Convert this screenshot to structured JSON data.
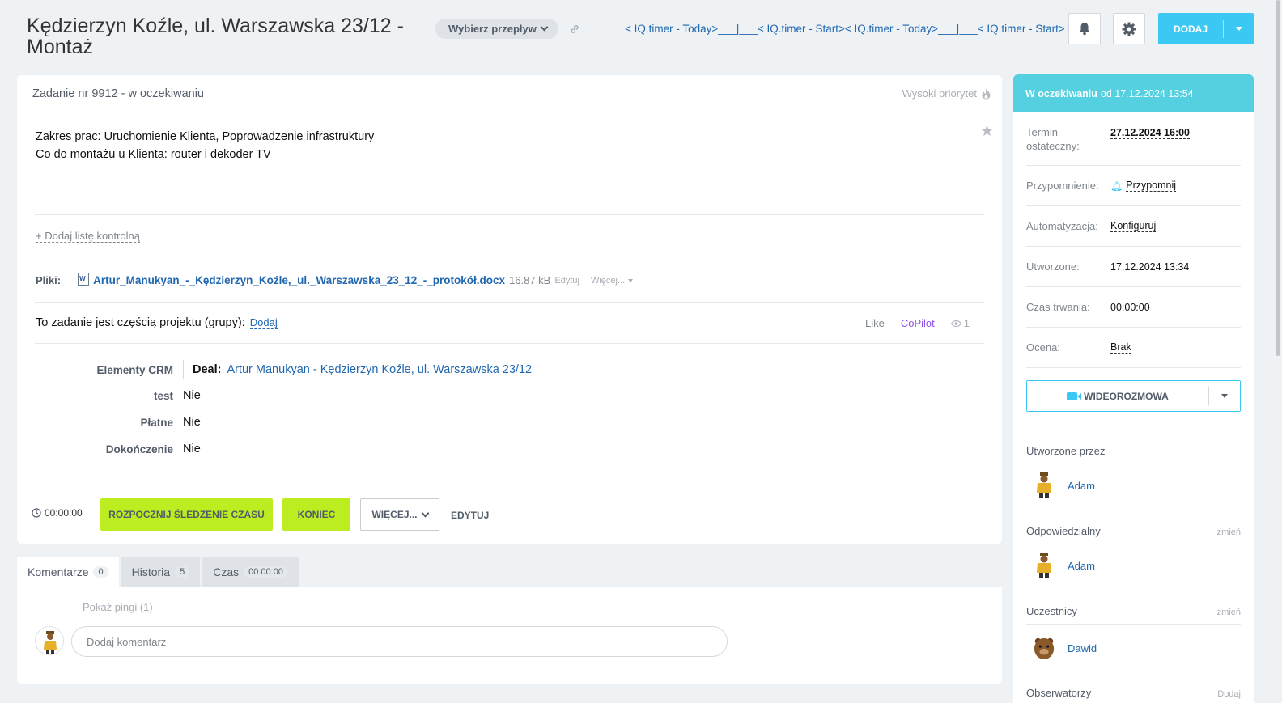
{
  "header": {
    "title": "Kędzierzyn Koźle, ul. Warszawska 23/12 - Montaż",
    "flow_button": "Wybierz przepływ",
    "iq_links": "< IQ.timer - Today>___|___< IQ.timer - Start>< IQ.timer - Today>___|___< IQ.timer - Start>",
    "add_button": "DODAJ"
  },
  "task": {
    "heading": "Zadanie nr 9912 - w oczekiwaniu",
    "priority": "Wysoki priorytet",
    "description_line1": "Zakres prac: Uruchomienie Klienta, Poprowadzenie infrastruktury",
    "description_line2": "Co do montażu u Klienta: router i dekoder TV",
    "add_checklist": "+ Dodaj listę kontrolną",
    "files_label": "Pliki:",
    "file_name": "Artur_Manukyan_-_Kędzierzyn_Koźle,_ul._Warszawska_23_12_-_protokół.docx",
    "file_size": "16.87 kB",
    "file_edit": "Edytuj",
    "file_more": "Więcej...",
    "project_text": "To zadanie jest częścią projektu (grupy):",
    "project_add": "Dodaj",
    "like": "Like",
    "copilot": "CoPilot",
    "views": "1",
    "fields": {
      "crm_label": "Elementy CRM",
      "deal_label": "Deal:",
      "deal_value": "Artur Manukyan - Kędzierzyn Koźle, ul. Warszawska 23/12",
      "test_label": "test",
      "test_value": "Nie",
      "paid_label": "Płatne",
      "paid_value": "Nie",
      "done_label": "Dokończenie",
      "done_value": "Nie"
    },
    "timer": "00:00:00",
    "start_tracking": "ROZPOCZNIJ ŚLEDZENIE CZASU",
    "finish": "KONIEC",
    "more": "WIĘCEJ...",
    "edit": "EDYTUJ"
  },
  "tabs": [
    {
      "label": "Komentarze",
      "count": "0"
    },
    {
      "label": "Historia",
      "count": "5"
    },
    {
      "label": "Czas",
      "count": "00:00:00"
    }
  ],
  "comments": {
    "show_pings": "Pokaż pingi (1)",
    "placeholder": "Dodaj komentarz"
  },
  "sidebar": {
    "status_bold": "W oczekiwaniu",
    "status_rest": "od 17.12.2024 13:54",
    "deadline_label": "Termin ostateczny:",
    "deadline_value": "27.12.2024 16:00",
    "reminder_label": "Przypomnienie:",
    "reminder_value": "Przypomnij",
    "automation_label": "Automatyzacja:",
    "automation_value": "Konfiguruj",
    "created_label": "Utworzone:",
    "created_value": "17.12.2024 13:34",
    "duration_label": "Czas trwania:",
    "duration_value": "00:00:00",
    "rating_label": "Ocena:",
    "rating_value": "Brak",
    "video_call": "WIDEOROZMOWA",
    "created_by_label": "Utworzone przez",
    "created_by": "Adam",
    "responsible_label": "Odpowiedzialny",
    "responsible_change": "zmień",
    "responsible": "Adam",
    "participants_label": "Uczestnicy",
    "participants_change": "zmień",
    "participant": "Dawid",
    "observers_label": "Obserwatorzy",
    "observers_add": "Dodaj"
  },
  "colors": {
    "accent_blue": "#3bc8f5",
    "status_header": "#55d0e0",
    "green_button": "#bbed21",
    "link": "#2067b0"
  }
}
